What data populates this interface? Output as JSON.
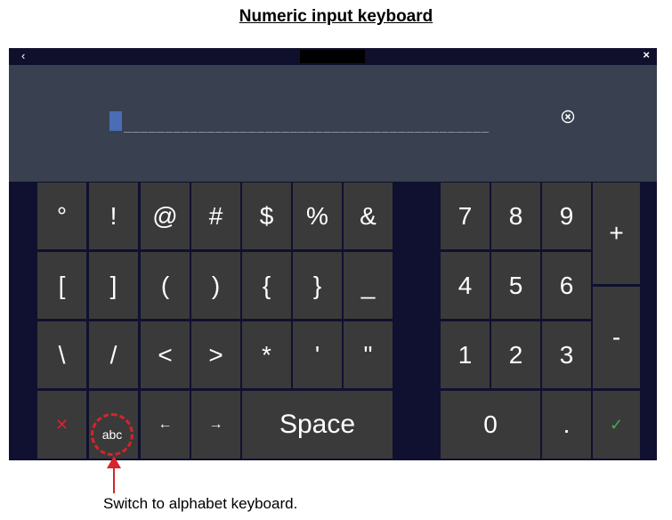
{
  "heading": "Numeric input keyboard",
  "titlebar": {
    "back": "‹",
    "close": "×"
  },
  "input": {
    "underline": "____________________________________________"
  },
  "symbols": {
    "row1": [
      "°",
      "!",
      "@",
      "#",
      "$",
      "%",
      "&"
    ],
    "row2": [
      "[",
      "]",
      "(",
      ")",
      "{",
      "}",
      "_"
    ],
    "row3": [
      "\\",
      "/",
      "<",
      ">",
      "*",
      "'",
      "\""
    ]
  },
  "bottom": {
    "cancel": "✕",
    "abc": "abc",
    "left": "←",
    "right": "→",
    "space": "Space"
  },
  "numpad": {
    "row1": [
      "7",
      "8",
      "9"
    ],
    "row2": [
      "4",
      "5",
      "6"
    ],
    "row3": [
      "1",
      "2",
      "3"
    ],
    "zero": "0",
    "dot": ".",
    "plus": "+",
    "minus": "-",
    "ok": "✓"
  },
  "caption": "Switch to alphabet keyboard.",
  "colors": {
    "cancel": "#d8232a",
    "ok": "#3fae49",
    "cursor": "#4b6db5"
  }
}
